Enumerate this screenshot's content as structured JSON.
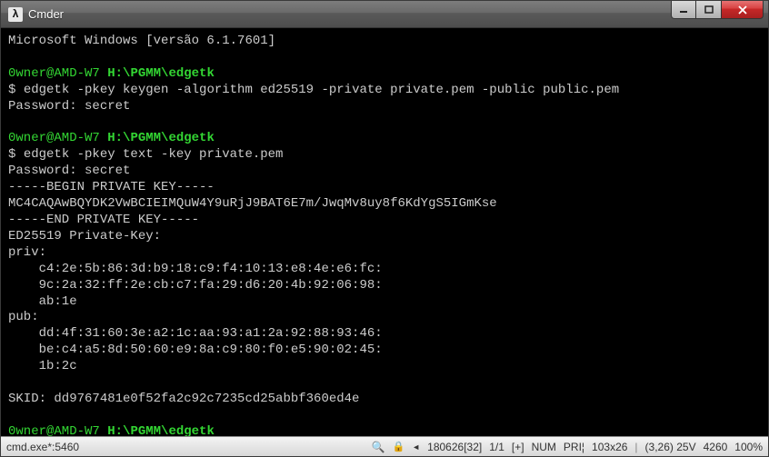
{
  "window": {
    "icon_glyph": "λ",
    "title": "Cmder"
  },
  "terminal": {
    "banner": "Microsoft Windows [versão 6.1.7601]",
    "blocks": [
      {
        "user": "0wner@AMD-W7",
        "path": "H:\\PGMM\\edgetk",
        "prompt": "$",
        "command": "edgetk -pkey keygen -algorithm ed25519 -private private.pem -public public.pem",
        "lines": [
          "Password: secret"
        ]
      },
      {
        "user": "0wner@AMD-W7",
        "path": "H:\\PGMM\\edgetk",
        "prompt": "$",
        "command": "edgetk -pkey text -key private.pem",
        "lines": [
          "Password: secret",
          "-----BEGIN PRIVATE KEY-----",
          "MC4CAQAwBQYDK2VwBCIEIMQuW4Y9uRjJ9BAT6E7m/JwqMv8uy8f6KdYgS5IGmKse",
          "-----END PRIVATE KEY-----",
          "ED25519 Private-Key:",
          "priv:",
          "    c4:2e:5b:86:3d:b9:18:c9:f4:10:13:e8:4e:e6:fc:",
          "    9c:2a:32:ff:2e:cb:c7:fa:29:d6:20:4b:92:06:98:",
          "    ab:1e",
          "pub:",
          "    dd:4f:31:60:3e:a2:1c:aa:93:a1:2a:92:88:93:46:",
          "    be:c4:a5:8d:50:60:e9:8a:c9:80:f0:e5:90:02:45:",
          "    1b:2c",
          "",
          "SKID: dd9767481e0f52fa2c92c7235cd25abbf360ed4e"
        ]
      },
      {
        "user": "0wner@AMD-W7",
        "path": "H:\\PGMM\\edgetk",
        "prompt": "$",
        "command": "",
        "lines": []
      }
    ]
  },
  "statusbar": {
    "process": "cmd.exe*:5460",
    "search_glyph": "🔍",
    "lock_glyph": "🔒",
    "tri_glyph": "◄",
    "pos": "180626[32]",
    "ratio": "1/1",
    "plus": "[+]",
    "num": "NUM",
    "pri": "PRI¦",
    "size": "103x26",
    "cursor": "(3,26) 25V",
    "mem": "4260",
    "pct": "100%"
  }
}
